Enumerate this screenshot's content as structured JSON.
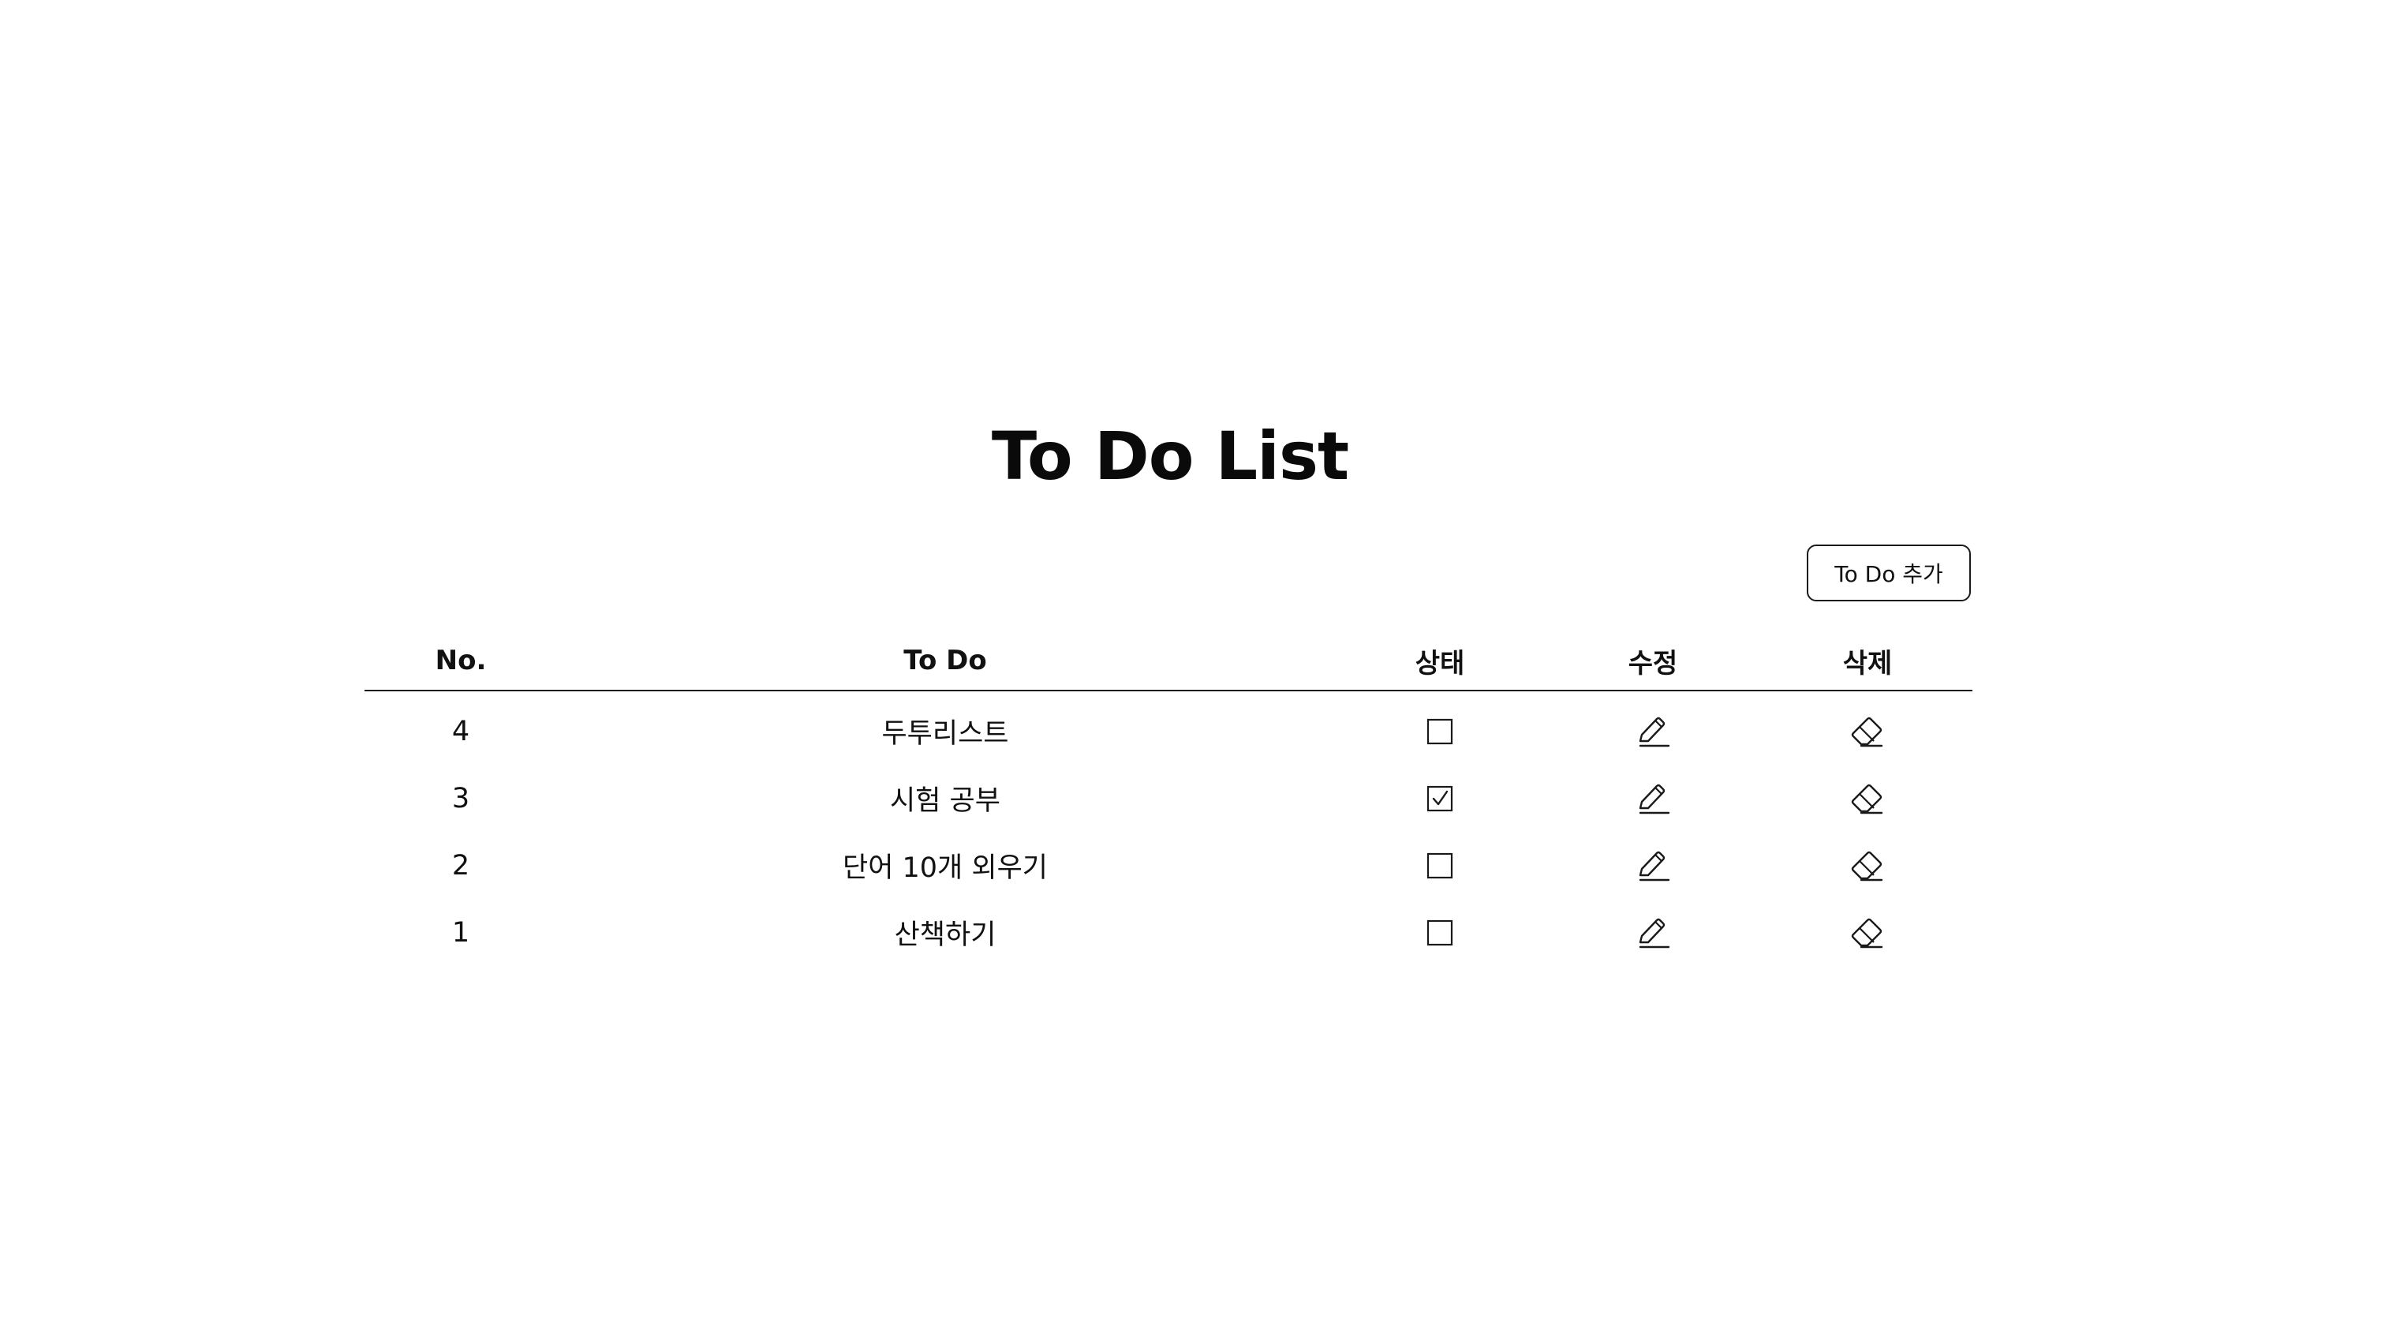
{
  "header": {
    "title": "To Do List",
    "add_button_label": "To Do 추가"
  },
  "table": {
    "columns": {
      "no": "No.",
      "todo": "To Do",
      "status": "상태",
      "edit": "수정",
      "delete": "삭제"
    },
    "rows": [
      {
        "no": "4",
        "todo": "두투리스트",
        "done": false,
        "edit_icon": "pencil-icon",
        "delete_icon": "eraser-icon"
      },
      {
        "no": "3",
        "todo": "시험 공부",
        "done": true,
        "edit_icon": "pencil-icon",
        "delete_icon": "eraser-icon"
      },
      {
        "no": "2",
        "todo": "단어 10개 외우기",
        "done": false,
        "edit_icon": "pencil-icon",
        "delete_icon": "eraser-icon"
      },
      {
        "no": "1",
        "todo": "산책하기",
        "done": false,
        "edit_icon": "pencil-icon",
        "delete_icon": "eraser-icon"
      }
    ]
  },
  "colors": {
    "text": "#111111",
    "border": "#1a1a1a",
    "background": "#ffffff"
  }
}
